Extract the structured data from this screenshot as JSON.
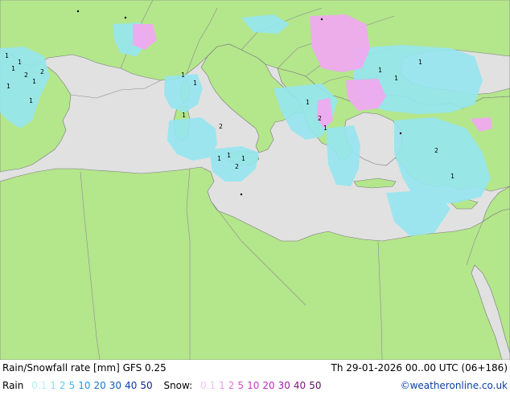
{
  "footer": {
    "title": "Rain/Snowfall rate [mm] GFS 0.25",
    "valid_time": "Th 29-01-2026 00..00 UTC (06+186)",
    "credit": "©weatheronline.co.uk"
  },
  "legend": {
    "rain_label": "Rain",
    "rain_values": [
      "0.1",
      "1",
      "2",
      "5",
      "10",
      "20",
      "30",
      "40",
      "50"
    ],
    "rain_colors": [
      "#b4f0f0",
      "#96dcf0",
      "#64c8f0",
      "#3cb4f0",
      "#1e96e6",
      "#1478d2",
      "#0a5abe",
      "#0a3caa",
      "#0a1e96"
    ],
    "snow_label": "Snow:",
    "snow_values": [
      "0.1",
      "1",
      "2",
      "5",
      "10",
      "20",
      "30",
      "40",
      "50"
    ],
    "snow_colors": [
      "#f0c8f0",
      "#e6a0e6",
      "#dc78dc",
      "#d250d2",
      "#c83cc8",
      "#be28be",
      "#a01ea0",
      "#821482",
      "#640a64"
    ]
  },
  "map": {
    "colors": {
      "land": "#b4e68c",
      "sea": "#e1e1e1",
      "border": "#8c8c8c",
      "coast": "#787878",
      "rain": "#96e6f0",
      "snow": "#f0aaf0",
      "marker": "#000000"
    },
    "precip_markers": [
      {
        "text": "1"
      },
      {
        "text": "1"
      },
      {
        "text": "1"
      },
      {
        "text": "2"
      },
      {
        "text": "1"
      },
      {
        "text": "1"
      },
      {
        "text": "2"
      },
      {
        "text": "1"
      },
      {
        "text": "1"
      },
      {
        "text": "1"
      },
      {
        "text": "1"
      },
      {
        "text": "2"
      },
      {
        "text": "1"
      },
      {
        "text": "1"
      },
      {
        "text": "2"
      },
      {
        "text": "1"
      },
      {
        "text": "1"
      },
      {
        "text": "2"
      },
      {
        "text": "1"
      },
      {
        "text": "1"
      },
      {
        "text": "1"
      },
      {
        "text": "1"
      },
      {
        "text": "2"
      },
      {
        "text": "1"
      }
    ]
  }
}
